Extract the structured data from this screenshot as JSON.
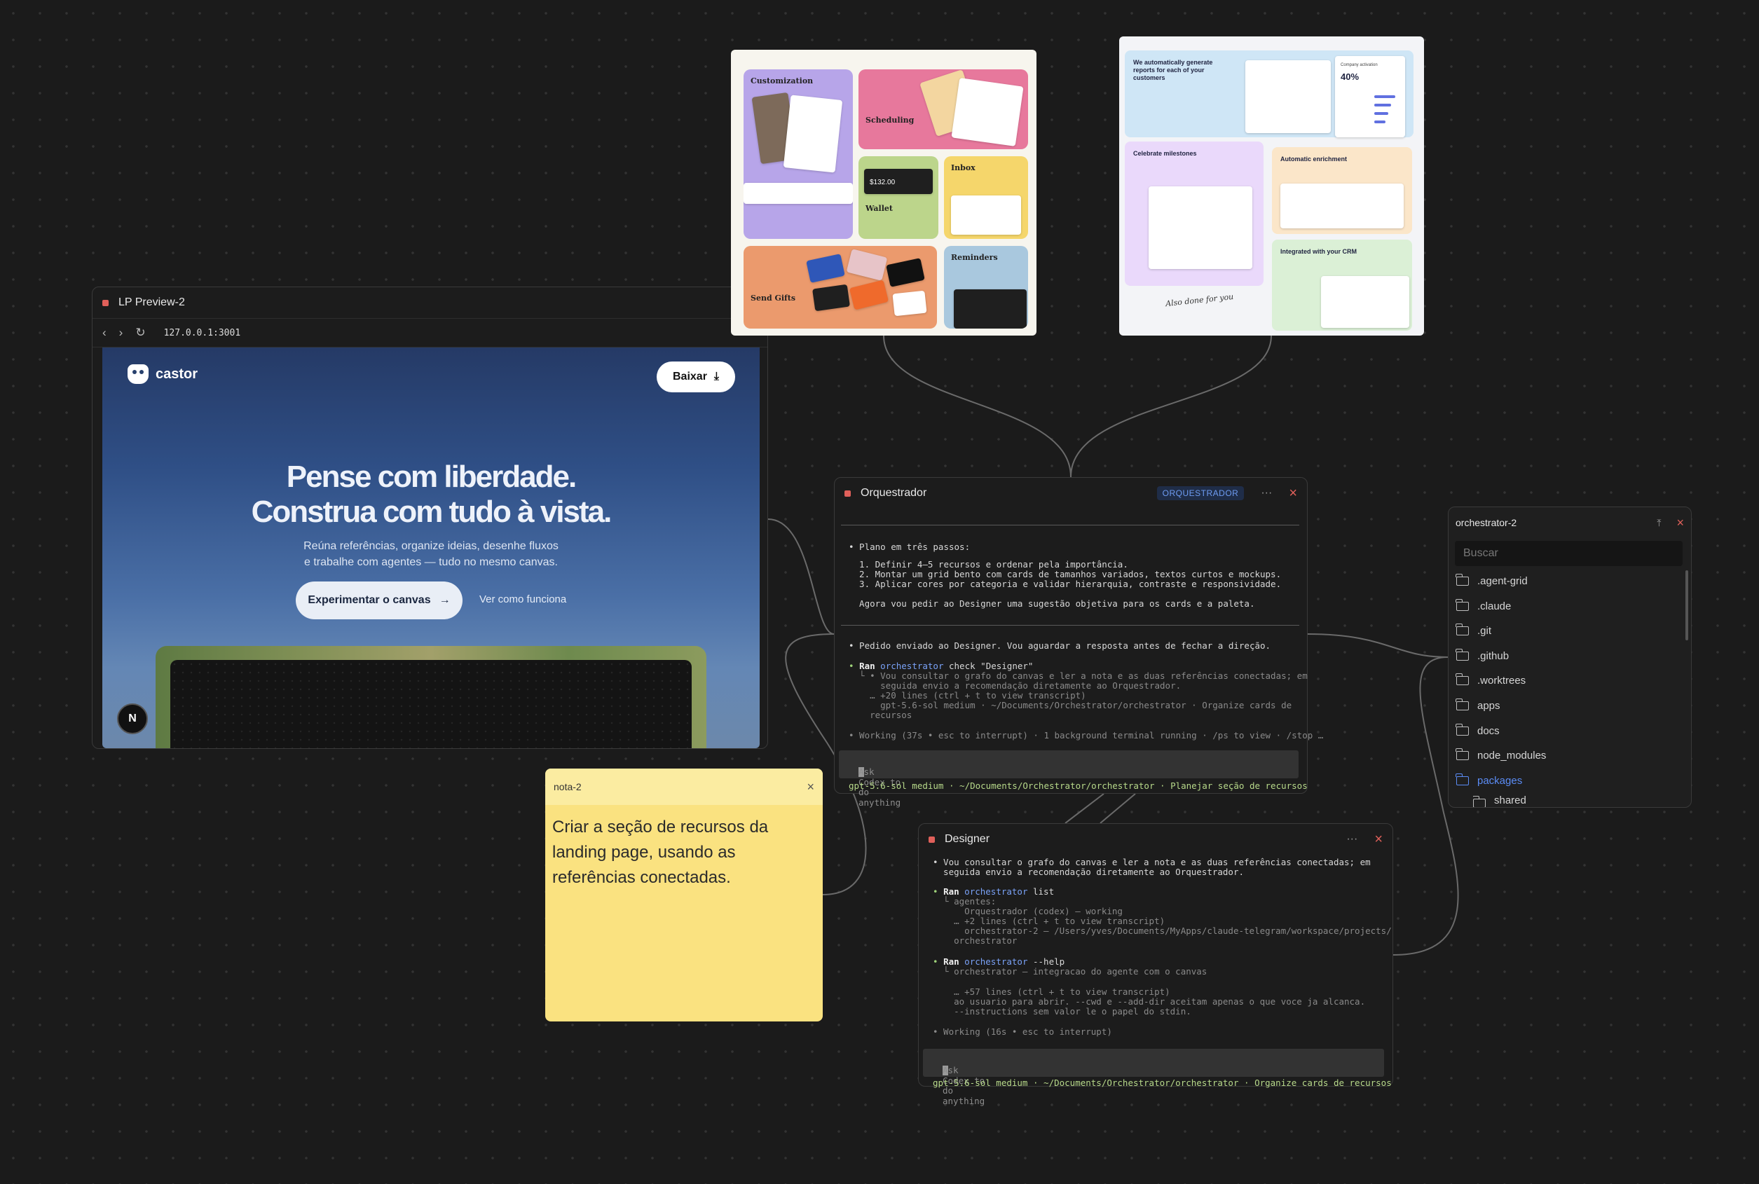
{
  "lp_preview": {
    "title": "LP Preview-2",
    "url": "127.0.0.1:3001",
    "brand": "castor",
    "download_label": "Baixar",
    "headline_1": "Pense com liberdade.",
    "headline_2": "Construa com tudo à vista.",
    "subtitle_1": "Reúna referências, organize ideias, desenhe fluxos",
    "subtitle_2": "e trabalhe com agentes — tudo no mesmo canvas.",
    "cta_primary": "Experimentar o canvas",
    "cta_secondary": "Ver como funciona",
    "badge_letter": "N"
  },
  "reference_1": {
    "cards": [
      "Customization",
      "Scheduling",
      "Wallet",
      "Inbox",
      "Send Gifts",
      "Reminders"
    ],
    "wallet_amount": "$132.00"
  },
  "reference_2": {
    "headline": "We automatically generate reports for each of your customers",
    "stat_label": "Company activation",
    "stat_value": "40%",
    "card_1": "Celebrate milestones",
    "card_2": "Automatic enrichment",
    "card_3": "Integrated with your CRM",
    "handwriting": "Also done for you"
  },
  "orchestrator": {
    "title": "Orquestrador",
    "badge": "ORQUESTRADOR",
    "menu": "···",
    "lines": {
      "l1": "• Plano em três passos:",
      "l2": "  1. Definir 4–5 recursos e ordenar pela importância.",
      "l3": "  2. Montar um grid bento com cards de tamanhos variados, textos curtos e mockups.",
      "l4": "  3. Aplicar cores por categoria e validar hierarquia, contraste e responsividade.",
      "l5": "  Agora vou pedir ao Designer uma sugestão objetiva para os cards e a paleta.",
      "l6": "• Pedido enviado ao Designer. Vou aguardar a resposta antes de fechar a direção.",
      "l7_ran": "Ran",
      "l7_cmd": "orchestrator",
      "l7_rest": " check \"Designer\"",
      "l8": "  └ • Vou consultar o grafo do canvas e ler a nota e as duas referências conectadas; em",
      "l9": "      seguida envio a recomendação diretamente ao Orquestrador.",
      "l10": "    … +20 lines (ctrl + t to view transcript)",
      "l11": "      gpt-5.6-sol medium · ~/Documents/Orchestrator/orchestrator · Organize cards de",
      "l12": "    recursos",
      "l13": "• Working (37s • esc to interrupt) · 1 background terminal running · /ps to view · /stop …"
    },
    "prompt_placeholder": "Ask Codex to do anything",
    "status": "gpt-5.6-sol medium · ~/Documents/Orchestrator/orchestrator · Planejar seção de recursos"
  },
  "designer": {
    "title": "Designer",
    "menu": "···",
    "lines": {
      "l1": "• Vou consultar o grafo do canvas e ler a nota e as duas referências conectadas; em",
      "l2": "  seguida envio a recomendação diretamente ao Orquestrador.",
      "l3_ran": "Ran",
      "l3_cmd": "orchestrator",
      "l3_rest": " list",
      "l4": "  └ agentes:",
      "l5": "      Orquestrador (codex) — working",
      "l6": "    … +2 lines (ctrl + t to view transcript)",
      "l7": "      orchestrator-2 — /Users/yves/Documents/MyApps/claude-telegram/workspace/projects/",
      "l8": "    orchestrator",
      "l9_ran": "Ran",
      "l9_cmd": "orchestrator",
      "l9_rest": " --help",
      "l10": "  └ orchestrator — integracao do agente com o canvas",
      "l11": "    … +57 lines (ctrl + t to view transcript)",
      "l12": "    ao usuario para abrir. --cwd e --add-dir aceitam apenas o que voce ja alcanca.",
      "l13": "    --instructions sem valor le o papel do stdin.",
      "l14": "• Working (16s • esc to interrupt)"
    },
    "prompt_placeholder": "Ask Codex to do anything",
    "status": "gpt-5.6-sol medium · ~/Documents/Orchestrator/orchestrator · Organize cards de recursos"
  },
  "note": {
    "title": "nota-2",
    "body": "Criar a seção de recursos da landing page, usando as referências conectadas."
  },
  "file_tree": {
    "title": "orchestrator-2",
    "search_placeholder": "Buscar",
    "items": [
      ".agent-grid",
      ".claude",
      ".git",
      ".github",
      ".worktrees",
      "apps",
      "docs",
      "node_modules",
      "packages",
      "shared"
    ]
  },
  "colors": {
    "canvas_bg": "#1b1b1b",
    "panel_bg": "#1f1f1f",
    "accent_blue": "#5b8cf5",
    "note_yellow": "#fae280",
    "close_red": "#e0605a"
  }
}
